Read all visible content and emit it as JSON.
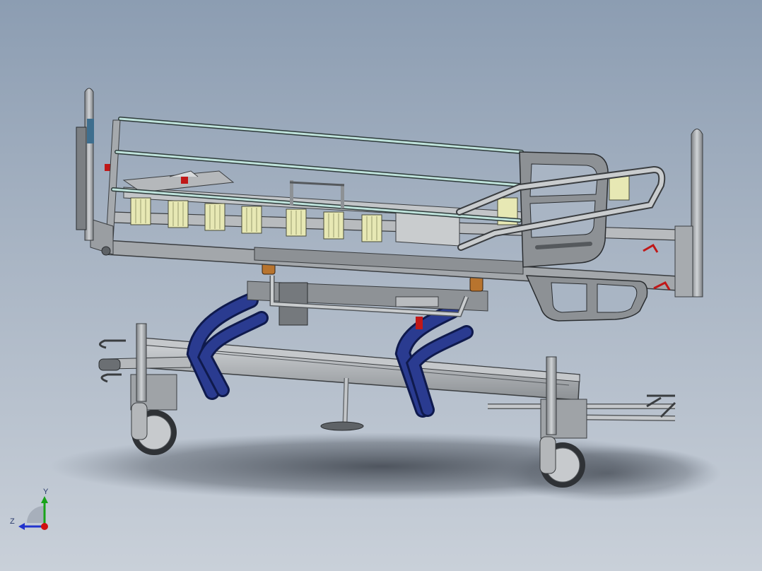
{
  "model": {
    "type": "3D CAD assembly view",
    "subject": "hospital-bed",
    "colors": {
      "background_top": "#8c9db2",
      "background_bottom": "#c9d0d9",
      "frame_gray": "#a8acb0",
      "frame_edge": "#3a3d40",
      "lift_arm_blue": "#1f2f7a",
      "rail_glass": "#bfe3dc",
      "slat_yellow": "#e7e8b4",
      "accent_red": "#c01818",
      "pivot_orange": "#b8742e"
    }
  },
  "triad": {
    "y_label": "Y",
    "z_label": "Z",
    "y_color": "#19a319",
    "z_color": "#2233cc",
    "x_color": "#d01010"
  }
}
